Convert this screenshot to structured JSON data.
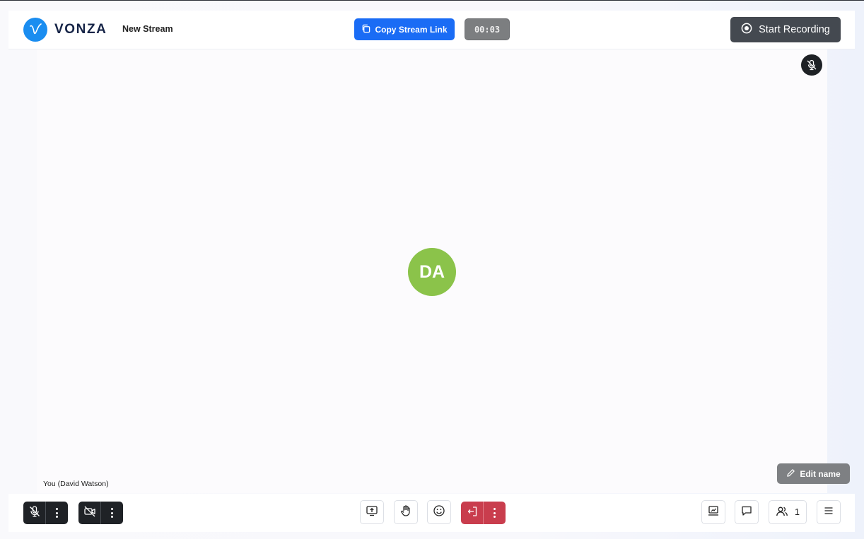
{
  "header": {
    "brand": "VONZA",
    "stream_name": "New Stream",
    "copy_link_label": "Copy Stream Link",
    "timer": "00:03",
    "record_label": "Start Recording"
  },
  "stage": {
    "avatar_initials": "DA",
    "participant_label": "You (David Watson)",
    "edit_name_label": "Edit name",
    "avatar_color": "#8bc34a"
  },
  "toolbar": {
    "participant_count": "1",
    "leave_color": "#c93d4d",
    "accent_color": "#1a6cf5"
  },
  "icons": {
    "logo": "vonza-logo-icon",
    "copy": "copy-icon",
    "record": "record-icon",
    "mic_off": "mic-off-icon",
    "camera_off": "camera-off-icon",
    "share_screen": "share-screen-icon",
    "raise_hand": "raise-hand-icon",
    "emoji": "emoji-icon",
    "leave": "leave-icon",
    "whiteboard": "whiteboard-icon",
    "chat": "chat-icon",
    "participants": "participants-icon",
    "menu": "menu-icon",
    "pencil": "pencil-icon"
  }
}
